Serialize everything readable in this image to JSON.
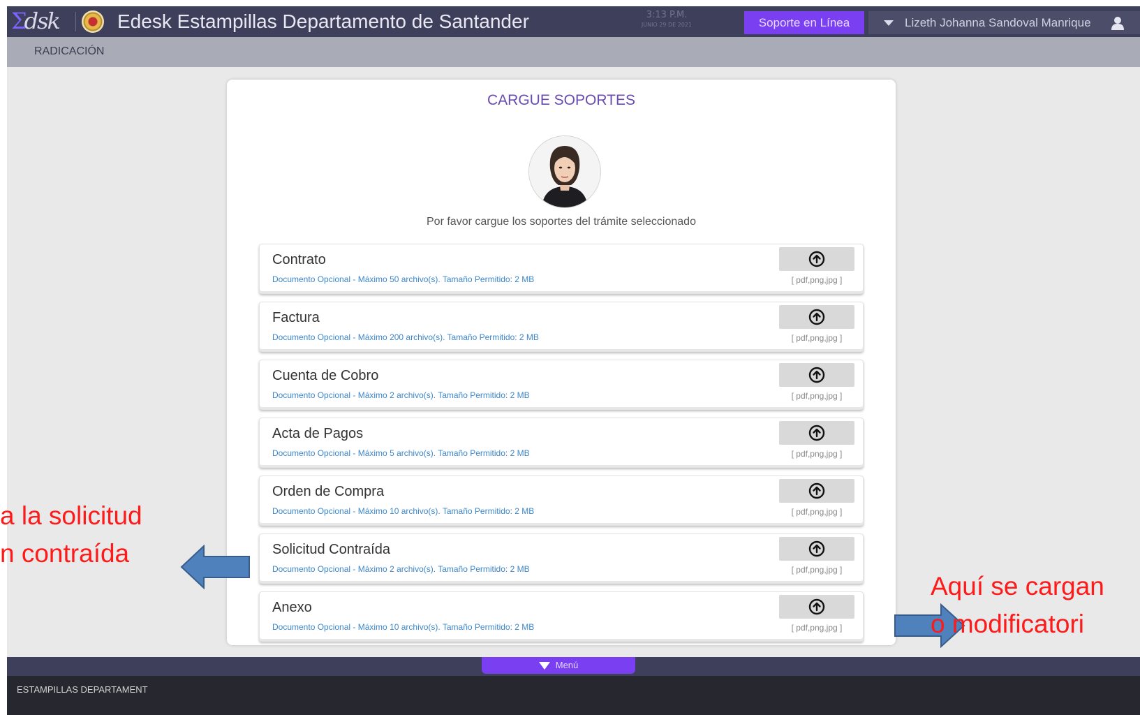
{
  "header": {
    "logo_text": "dsk",
    "title": "Edesk Estampillas Departamento de Santander",
    "time": "3:13 P.M.",
    "date": "JUNIO 29 DE 2021",
    "support_label": "Soporte en Línea",
    "user_name": "Lizeth Johanna Sandoval Manrique"
  },
  "subnav": {
    "label": "RADICACIÓN"
  },
  "panel": {
    "title": "CARGUE SOPORTES",
    "instructions": "Por favor cargue los soportes del trámite seleccionado",
    "documents": [
      {
        "name": "Contrato",
        "description": "Documento Opcional - Máximo 50 archivo(s). Tamaño Permitido: 2 MB",
        "formats": "[ pdf,png,jpg ]"
      },
      {
        "name": "Factura",
        "description": "Documento Opcional - Máximo 200 archivo(s). Tamaño Permitido: 2 MB",
        "formats": "[ pdf,png,jpg ]"
      },
      {
        "name": "Cuenta de Cobro",
        "description": "Documento Opcional - Máximo 2 archivo(s). Tamaño Permitido: 2 MB",
        "formats": "[ pdf,png,jpg ]"
      },
      {
        "name": "Acta de Pagos",
        "description": "Documento Opcional - Máximo 5 archivo(s). Tamaño Permitido: 2 MB",
        "formats": "[ pdf,png,jpg ]"
      },
      {
        "name": "Orden de Compra",
        "description": "Documento Opcional - Máximo 10 archivo(s). Tamaño Permitido: 2 MB",
        "formats": "[ pdf,png,jpg ]"
      },
      {
        "name": "Solicitud Contraída",
        "description": "Documento Opcional - Máximo 2 archivo(s). Tamaño Permitido: 2 MB",
        "formats": "[ pdf,png,jpg ]"
      },
      {
        "name": "Anexo",
        "description": "Documento Opcional - Máximo 10 archivo(s). Tamaño Permitido: 2 MB",
        "formats": "[ pdf,png,jpg ]"
      }
    ]
  },
  "footer": {
    "menu_label": "Menú",
    "text": "ESTAMPILLAS DEPARTAMENT"
  },
  "annotations": {
    "left_line1": "a la solicitud",
    "left_line2": "n contraída",
    "right_line1": "Aquí se cargan",
    "right_line2": "o modificatori"
  },
  "colors": {
    "accent_purple": "#7b3ff2",
    "header_bg": "#3e3f5b",
    "annotation_red": "#ff1a1a",
    "arrow_blue": "#4f81bd"
  },
  "icons": {
    "upload": "upload-circle-arrow-icon",
    "user": "user-icon",
    "caret": "caret-down-icon"
  }
}
